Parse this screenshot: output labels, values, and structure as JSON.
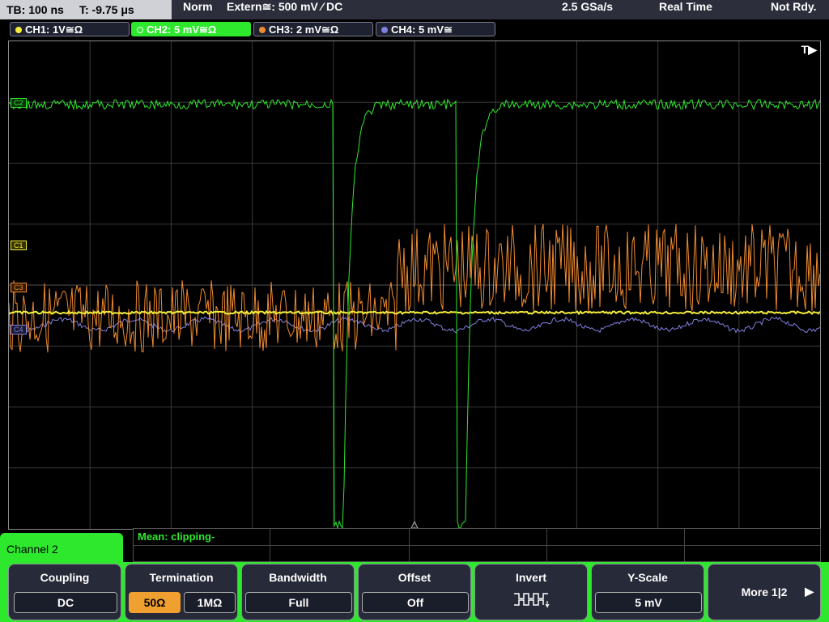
{
  "top_bar": {
    "timebase": "TB: 100 ns",
    "trigger_time": "T: -9.75 μs",
    "trigger_mode": "Norm",
    "trigger_source": "Extern≅: 500 mV ⁄ DC",
    "sample_rate": "2.5 GSa/s",
    "acq_mode": "Real Time",
    "status": "Not Rdy."
  },
  "channel_tabs": [
    {
      "label": "CH1: 1V≅Ω",
      "color": "#f5f03a"
    },
    {
      "label": "CH2: 5 mV≅Ω",
      "color": "#2ee82e",
      "active": true
    },
    {
      "label": "CH3: 2 mV≅Ω",
      "color": "#f08a30"
    },
    {
      "label": "CH4: 5 mV≅",
      "color": "#8080e0"
    }
  ],
  "screen": {
    "trigger_marker": "T▶",
    "markers": {
      "c1": "C1",
      "c2": "C2",
      "c3": "C3",
      "c4": "C4"
    },
    "colors": {
      "ch1": "#f5f03a",
      "ch2": "#2ee82e",
      "ch3": "#f08a30",
      "ch4": "#8080e0",
      "grid": "#3a3a3a"
    }
  },
  "result": {
    "text": "Mean: clipping-"
  },
  "channel_label": "Channel 2",
  "softkeys": {
    "coupling": {
      "title": "Coupling",
      "value": "DC"
    },
    "termination": {
      "title": "Termination",
      "opt1": "50Ω",
      "opt2": "1MΩ"
    },
    "bandwidth": {
      "title": "Bandwidth",
      "value": "Full"
    },
    "offset": {
      "title": "Offset",
      "value": "Off"
    },
    "invert": {
      "title": "Invert",
      "icon": "invert-wave-icon"
    },
    "yscale": {
      "title": "Y-Scale",
      "value": "5 mV"
    },
    "more": {
      "label": "More 1|2"
    }
  }
}
